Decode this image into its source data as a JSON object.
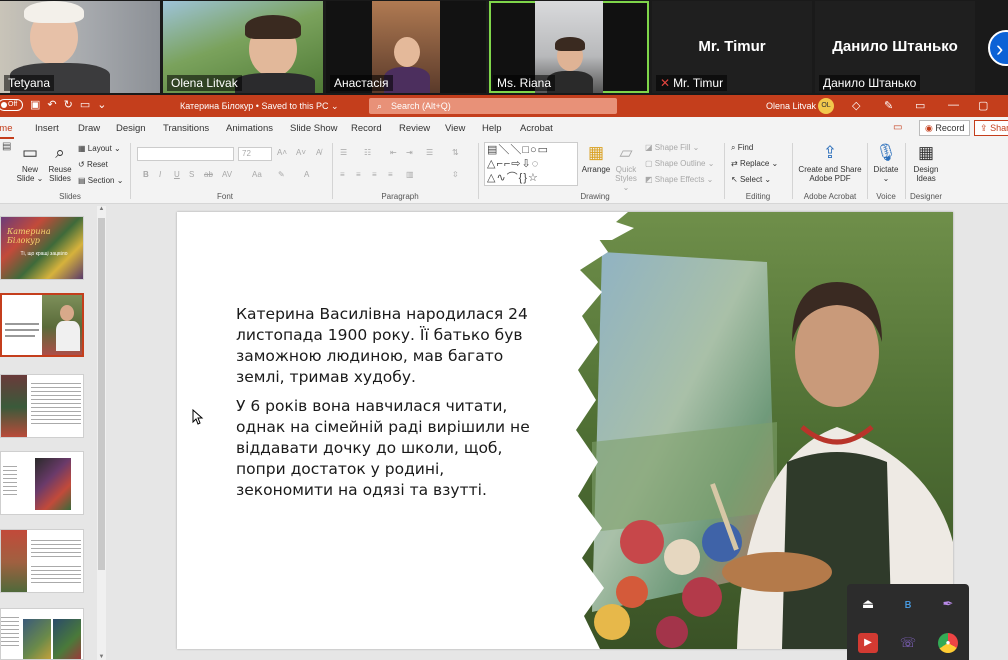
{
  "video": {
    "participants": [
      {
        "name": "Tetyana"
      },
      {
        "name": "Olena Litvak"
      },
      {
        "name": "Анастасія"
      },
      {
        "name": "Ms. Riana"
      },
      {
        "name": "Mr. Timur",
        "display": "Mr. Timur",
        "muted": true
      },
      {
        "name": "Данило Штанько",
        "display": "Данило Штанько"
      }
    ],
    "next_icon": "chevron-right"
  },
  "titlebar": {
    "autosave": "Off",
    "doc_title": "Катерина Білокур • Saved to this PC ⌄",
    "search_placeholder": "Search (Alt+Q)",
    "user_name": "Olena Litvak",
    "user_initials": "OL",
    "accent": "#c43e1c"
  },
  "tabs": {
    "items": [
      "ome",
      "Insert",
      "Draw",
      "Design",
      "Transitions",
      "Animations",
      "Slide Show",
      "Record",
      "Review",
      "View",
      "Help",
      "Acrobat"
    ],
    "record_button": "Record",
    "share_button": "Shar"
  },
  "ribbon": {
    "slides": {
      "new_slide": "New\nSlide ⌄",
      "reuse_slides": "Reuse\nSlides",
      "layout": "Layout ⌄",
      "reset": "Reset",
      "section": "Section ⌄",
      "label": "Slides"
    },
    "font": {
      "label": "Font",
      "size": "72",
      "bold": "B",
      "italic": "I",
      "underline": "U",
      "strike": "S",
      "spacing": "ab"
    },
    "paragraph": {
      "label": "Paragraph"
    },
    "drawing": {
      "label": "Drawing",
      "arrange": "Arrange",
      "quick_styles": "Quick\nStyles ⌄",
      "shape_fill": "Shape Fill ⌄",
      "shape_outline": "Shape Outline ⌄",
      "shape_effects": "Shape Effects ⌄"
    },
    "editing": {
      "label": "Editing",
      "find": "Find",
      "replace": "Replace ⌄",
      "select": "Select ⌄"
    },
    "acrobat": {
      "label": "Adobe Acrobat",
      "create": "Create and Share\nAdobe PDF"
    },
    "voice": {
      "label": "Voice",
      "dictate": "Dictate\n⌄"
    },
    "designer": {
      "label": "Designer",
      "design_ideas": "Design\nIdeas"
    }
  },
  "thumbnails": {
    "slide1_title": "Катерина Білокур",
    "slide1_sub": "Ті, що кращі зацвіло"
  },
  "slide": {
    "paragraphs": [
      "Катерина Василівна народилася 24 листопада 1900 року.  Її батько був заможною людиною, мав багато землі, тримав худобу.",
      "У 6 років вона навчилася читати, однак на сімейній раді вирішили не віддавати дочку до школи, щоб, попри достаток у родині, зекономити на одязі та взутті."
    ]
  },
  "tray": {
    "icons": [
      "usb-drive-icon",
      "bluetooth-icon",
      "feather-icon",
      "recorder-icon",
      "viber-icon",
      "chrome-icon"
    ]
  }
}
